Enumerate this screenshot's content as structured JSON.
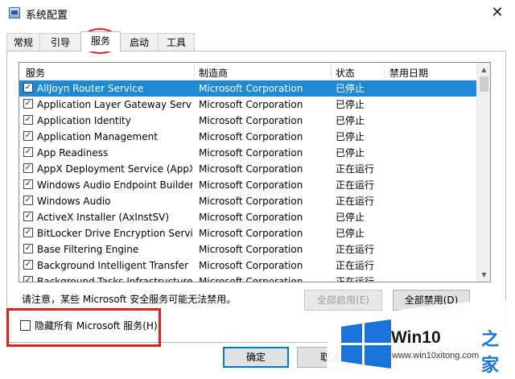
{
  "window": {
    "title": "系统配置",
    "close_glyph": "✕"
  },
  "tabs": [
    {
      "label": "常规"
    },
    {
      "label": "引导"
    },
    {
      "label": "服务",
      "active": true
    },
    {
      "label": "启动"
    },
    {
      "label": "工具"
    }
  ],
  "columns": {
    "service": "服务",
    "manufacturer": "制造商",
    "status": "状态",
    "disabled_date": "禁用日期"
  },
  "services": [
    {
      "name": "AllJoyn Router Service",
      "manufacturer": "Microsoft Corporation",
      "status": "已停止",
      "checked": true,
      "selected": true
    },
    {
      "name": "Application Layer Gateway Service",
      "manufacturer": "Microsoft Corporation",
      "status": "已停止",
      "checked": true
    },
    {
      "name": "Application Identity",
      "manufacturer": "Microsoft Corporation",
      "status": "已停止",
      "checked": true
    },
    {
      "name": "Application Management",
      "manufacturer": "Microsoft Corporation",
      "status": "已停止",
      "checked": true
    },
    {
      "name": "App Readiness",
      "manufacturer": "Microsoft Corporation",
      "status": "已停止",
      "checked": true
    },
    {
      "name": "AppX Deployment Service (AppX...",
      "manufacturer": "Microsoft Corporation",
      "status": "正在运行",
      "checked": true
    },
    {
      "name": "Windows Audio Endpoint Builder",
      "manufacturer": "Microsoft Corporation",
      "status": "正在运行",
      "checked": true
    },
    {
      "name": "Windows Audio",
      "manufacturer": "Microsoft Corporation",
      "status": "正在运行",
      "checked": true
    },
    {
      "name": "ActiveX Installer (AxInstSV)",
      "manufacturer": "Microsoft Corporation",
      "status": "已停止",
      "checked": true
    },
    {
      "name": "BitLocker Drive Encryption Service",
      "manufacturer": "Microsoft Corporation",
      "status": "已停止",
      "checked": true
    },
    {
      "name": "Base Filtering Engine",
      "manufacturer": "Microsoft Corporation",
      "status": "正在运行",
      "checked": true
    },
    {
      "name": "Background Intelligent Transfer ...",
      "manufacturer": "Microsoft Corporation",
      "status": "正在运行",
      "checked": true
    },
    {
      "name": "Background Tasks Infrastructure ...",
      "manufacturer": "Microsoft Corporation",
      "status": "正在运行",
      "checked": true
    }
  ],
  "scrollbar": {
    "up_glyph": "▲",
    "down_glyph": "▼"
  },
  "note": "请注意，某些 Microsoft 安全服务可能无法禁用。",
  "buttons": {
    "enable_all": "全部启用(E)",
    "disable_all": "全部禁用(D)",
    "ok": "确定",
    "cancel": "取消"
  },
  "hide_ms_services": {
    "label": "隐藏所有 Microsoft 服务(H)",
    "checked": false
  },
  "watermark": {
    "brand": "Win10",
    "brand_suffix": "之家",
    "url": "www.win10xitong.com"
  },
  "annotation_color": "#e02020",
  "accent_color": "#1e8ad6"
}
